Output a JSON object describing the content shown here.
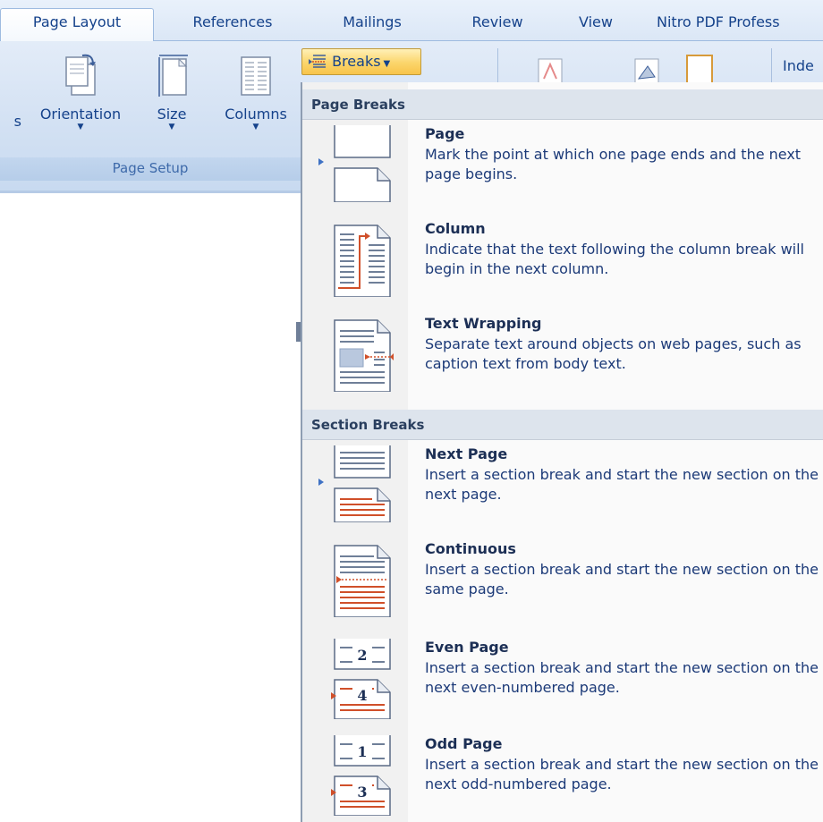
{
  "tabs": [
    {
      "label": "Page Layout",
      "active": true
    },
    {
      "label": "References"
    },
    {
      "label": "Mailings"
    },
    {
      "label": "Review"
    },
    {
      "label": "View"
    },
    {
      "label": "Nitro PDF Profess"
    }
  ],
  "ribbon": {
    "buttons": {
      "margins_partial": "s",
      "orientation": "Orientation",
      "size": "Size",
      "columns": "Columns",
      "breaks": "Breaks",
      "indent_partial": "Inde"
    },
    "group_label": "Page Setup"
  },
  "menu": {
    "page_breaks_header": "Page Breaks",
    "section_breaks_header": "Section Breaks",
    "items": [
      {
        "title": "Page",
        "description": "Mark the point at which one page ends and the next page begins.",
        "icon": "page-break-icon"
      },
      {
        "title": "Column",
        "description": "Indicate that the text following the column break will begin in the next column.",
        "icon": "column-break-icon"
      },
      {
        "title": "Text Wrapping",
        "description": "Separate text around objects on web pages, such as caption text from body text.",
        "icon": "text-wrapping-icon"
      },
      {
        "title": "Next Page",
        "description": "Insert a section break and start the new section on the next page.",
        "icon": "next-page-icon"
      },
      {
        "title": "Continuous",
        "description": "Insert a section break and start the new section on the same page.",
        "icon": "continuous-icon"
      },
      {
        "title": "Even Page",
        "description": "Insert a section break and start the new section on the next even-numbered page.",
        "icon": "even-page-icon",
        "numbers": [
          "2",
          "4"
        ]
      },
      {
        "title": "Odd Page",
        "description": "Insert a section break and start the new section on the next odd-numbered page.",
        "icon": "odd-page-icon",
        "numbers": [
          "1",
          "3"
        ]
      }
    ]
  },
  "colors": {
    "accent_text": "#15428b",
    "breaks_highlight": "#fbd56b",
    "break_marker": "#d0502a"
  }
}
